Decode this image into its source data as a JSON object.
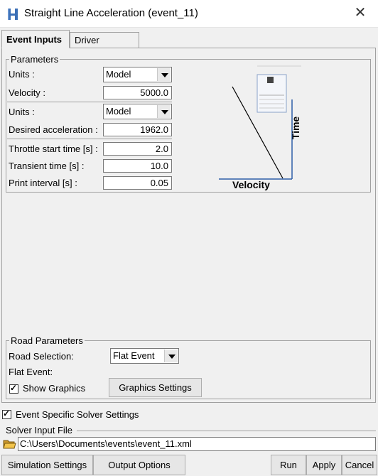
{
  "window": {
    "title": "Straight Line Acceleration (event_11)",
    "close_glyph": "✕"
  },
  "tabs": [
    {
      "label": "Event Inputs",
      "active": true
    },
    {
      "label": "Driver",
      "active": false
    }
  ],
  "parameters": {
    "legend": "Parameters",
    "units1_label": "Units :",
    "units1_value": "Model",
    "velocity_label": "Velocity :",
    "velocity_value": "5000.0",
    "units2_label": "Units :",
    "units2_value": "Model",
    "accel_label": "Desired acceleration :",
    "accel_value": "1962.0",
    "throttle_label": "Throttle start time [s] :",
    "throttle_value": "2.0",
    "transient_label": "Transient time [s] :",
    "transient_value": "10.0",
    "print_label": "Print interval [s] :",
    "print_value": "0.05"
  },
  "diagram": {
    "x_label": "Velocity",
    "y_label": "Time"
  },
  "road": {
    "legend": "Road Parameters",
    "selection_label": "Road Selection:",
    "selection_value": "Flat Event",
    "flat_event_label": "Flat Event:",
    "show_graphics_label": "Show Graphics",
    "show_graphics_checked": true,
    "graphics_settings_button": "Graphics Settings"
  },
  "solver": {
    "event_specific_label": "Event Specific Solver Settings",
    "event_specific_checked": true,
    "input_file_legend": "Solver Input File",
    "input_file_path": "C:\\Users\\Documents\\events\\event_11.xml"
  },
  "footer": {
    "simulation_settings": "Simulation Settings",
    "output_options": "Output Options",
    "run": "Run",
    "apply": "Apply",
    "cancel": "Cancel"
  },
  "colors": {
    "accent_blue": "#3b6fb6",
    "diagram_axis": "#2f5fa8"
  },
  "icons": {
    "app": "app-logo-icon",
    "folder": "folder-open-icon",
    "dropdown": "chevron-down-icon"
  }
}
